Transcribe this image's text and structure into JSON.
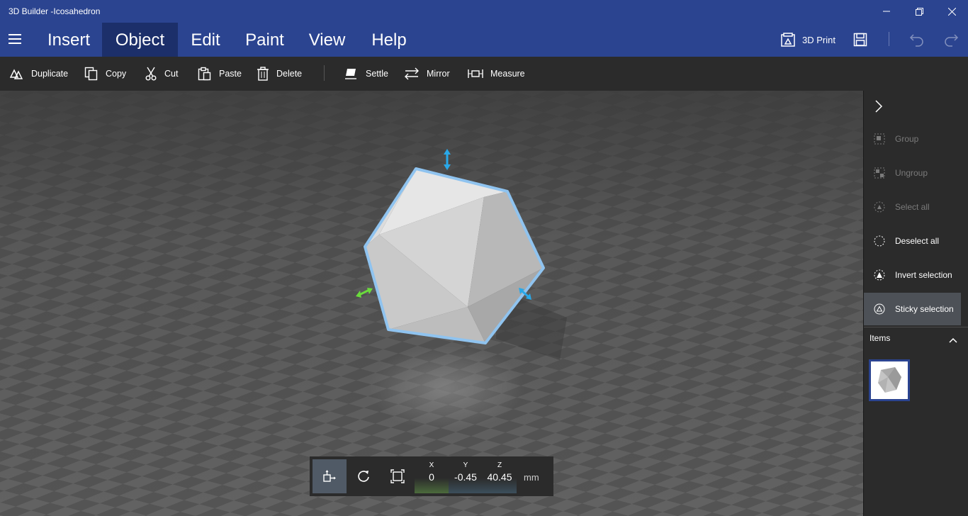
{
  "window": {
    "title": "3D Builder -Icosahedron"
  },
  "menu": {
    "tabs": [
      {
        "label": "Insert"
      },
      {
        "label": "Object"
      },
      {
        "label": "Edit"
      },
      {
        "label": "Paint"
      },
      {
        "label": "View"
      },
      {
        "label": "Help"
      }
    ],
    "active_tab": "Object",
    "print_label": "3D Print"
  },
  "toolbar": {
    "duplicate": "Duplicate",
    "copy": "Copy",
    "cut": "Cut",
    "paste": "Paste",
    "delete": "Delete",
    "settle": "Settle",
    "mirror": "Mirror",
    "measure": "Measure"
  },
  "panel": {
    "group": "Group",
    "ungroup": "Ungroup",
    "select_all": "Select all",
    "deselect_all": "Deselect all",
    "invert_selection": "Invert selection",
    "sticky_selection": "Sticky selection",
    "items_header": "Items"
  },
  "transform": {
    "x_label": "X",
    "x_value": "0",
    "y_label": "Y",
    "y_value": "-0.45",
    "z_label": "Z",
    "z_value": "40.45",
    "unit": "mm"
  },
  "colors": {
    "title_bar": "#2b4490",
    "active_tab": "#1c2f6a",
    "toolbar": "#2b2b2b",
    "selection_outline": "#8fc3ef",
    "gizmo_blue": "#29a8e8",
    "gizmo_green": "#6adb3c"
  }
}
